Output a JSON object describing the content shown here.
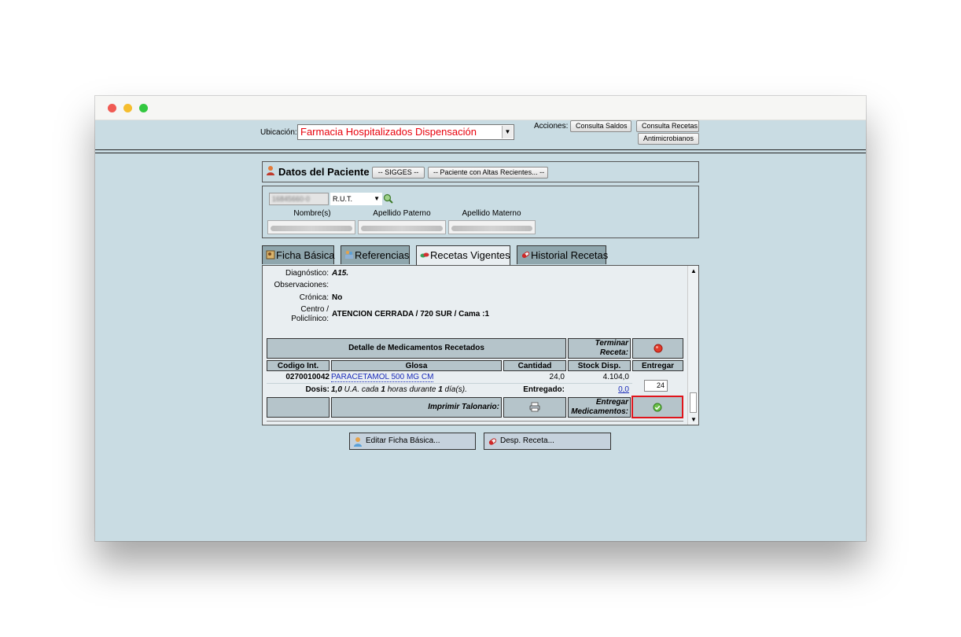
{
  "location": {
    "label": "Ubicación:",
    "value": "Farmacia Hospitalizados Dispensación"
  },
  "actions": {
    "label": "Acciones:",
    "consulta_saldos": "Consulta Saldos",
    "consulta_recetas": "Consulta Recetas",
    "antimicrobianos": "Antimicrobianos"
  },
  "patient": {
    "title": "Datos del Paciente",
    "sigges_button": "-- SIGGES --",
    "altas_button": "-- Paciente con Altas Recientes... --",
    "rut_value": "16845660-0",
    "id_type": "R.U.T.",
    "labels": {
      "nombres": "Nombre(s)",
      "apellido_paterno": "Apellido Paterno",
      "apellido_materno": "Apellido Materno"
    }
  },
  "tabs": [
    {
      "label": "Ficha Básica"
    },
    {
      "label": "Referencias"
    },
    {
      "label": "Recetas Vigentes"
    },
    {
      "label": "Historial Recetas"
    }
  ],
  "prescription": {
    "diagnostico_label": "Diagnóstico:",
    "diagnostico_value": "A15.",
    "observaciones_label": "Observaciones:",
    "cronica_label": "Crónica:",
    "cronica_value": "No",
    "centro_label_1": "Centro /",
    "centro_label_2": "Policlínico:",
    "centro_value": "ATENCION CERRADA / 720 SUR / Cama :1"
  },
  "detail": {
    "title": "Detalle de Medicamentos Recetados",
    "terminar_label_1": "Terminar",
    "terminar_label_2": "Receta:",
    "columns": [
      "Codigo Int.",
      "Glosa",
      "Cantidad",
      "Stock Disp.",
      "Entregar"
    ],
    "row": {
      "codigo": "0270010042",
      "glosa": "PARACETAMOL 500 MG CM",
      "cantidad": "24,0",
      "stock": "4.104,0",
      "entregar": "24"
    },
    "dosis_label": "Dosis:",
    "dosis_qty": "1,0",
    "dosis_unit": " U.A. cada ",
    "dosis_freq": "1",
    "dosis_mid": " horas durante ",
    "dosis_days": "1",
    "dosis_end": " día(s).",
    "entregado_label": "Entregado:",
    "entregado_value": "0,0",
    "imprimir_label": "Imprimir Talonario:",
    "entregar_med_label_1": "Entregar",
    "entregar_med_label_2": "Medicamentos:"
  },
  "bottom_buttons": {
    "editar": "Editar Ficha Básica...",
    "desp": "Desp. Receta..."
  },
  "colors": {
    "background": "#c9dce3",
    "location_text": "#e8000b",
    "highlight": "#e0141b",
    "link": "#1a2bb8"
  }
}
